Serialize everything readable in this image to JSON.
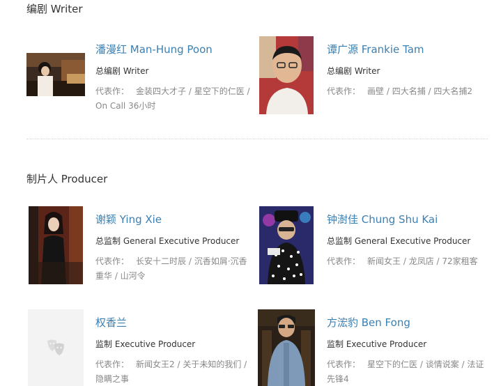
{
  "sections": {
    "writer": {
      "title": "编剧 Writer"
    },
    "producer": {
      "title": "制片人 Producer"
    }
  },
  "works_label": "代表作：",
  "people": [
    {
      "name": "潘漫红 Man-Hung Poon",
      "role": "总编剧 Writer",
      "works_line1": "金装四大才子 / 星空下的仁医 /",
      "works_line2": "On Call 36小时"
    },
    {
      "name": "谭广源 Frankie Tam",
      "role": "总编剧 Writer",
      "works_line1": "画壁 / 四大名捕 / 四大名捕2",
      "works_line2": ""
    },
    {
      "name": "谢颖 Ying Xie",
      "role": "总监制 General Executive Producer",
      "works_line1": "长安十二时辰 / 沉香如屑·沉香",
      "works_line2": "重华 / 山河令"
    },
    {
      "name": "钟澍佳 Chung Shu Kai",
      "role": "总监制 General Executive Producer",
      "works_line1": "新闻女王 / 龙凤店 / 72家租客",
      "works_line2": ""
    },
    {
      "name": "权香兰",
      "role": "监制 Executive Producer",
      "works_line1": "新闻女王2 / 关于未知的我们 /",
      "works_line2": "隐瞒之事"
    },
    {
      "name": "方浤豹 Ben Fong",
      "role": "监制 Executive Producer",
      "works_line1": "星空下的仁医 / 谈情说案 / 法证",
      "works_line2": "先锋4"
    }
  ],
  "colors": {
    "link": "#3c7fb1",
    "muted": "#888888",
    "divider": "#d6d6d6"
  }
}
